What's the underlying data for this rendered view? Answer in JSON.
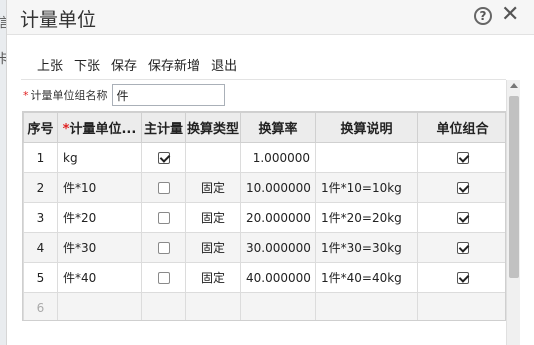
{
  "backdrop": {
    "text1": "信",
    "text2": "卡"
  },
  "window": {
    "title": "计量单位"
  },
  "toolbar": {
    "buttons": [
      "上张",
      "下张",
      "保存",
      "保存新增",
      "退出"
    ]
  },
  "form": {
    "group_name_label": "计量单位组名称",
    "group_name_value": "件"
  },
  "grid": {
    "headers": {
      "seq": "序号",
      "unit_name": "计量单位...",
      "main_unit": "主计量",
      "conv_type": "换算类型",
      "conv_rate": "换算率",
      "conv_desc": "换算说明",
      "unit_group": "单位组合"
    },
    "rows": [
      {
        "seq": "1",
        "unit_name": "kg",
        "main_unit": true,
        "conv_type": "",
        "conv_rate": "1.000000",
        "conv_desc": "",
        "unit_group": true
      },
      {
        "seq": "2",
        "unit_name": "件*10",
        "main_unit": false,
        "conv_type": "固定",
        "conv_rate": "10.000000",
        "conv_desc": "1件*10=10kg",
        "unit_group": true
      },
      {
        "seq": "3",
        "unit_name": "件*20",
        "main_unit": false,
        "conv_type": "固定",
        "conv_rate": "20.000000",
        "conv_desc": "1件*20=20kg",
        "unit_group": true
      },
      {
        "seq": "4",
        "unit_name": "件*30",
        "main_unit": false,
        "conv_type": "固定",
        "conv_rate": "30.000000",
        "conv_desc": "1件*30=30kg",
        "unit_group": true
      },
      {
        "seq": "5",
        "unit_name": "件*40",
        "main_unit": false,
        "conv_type": "固定",
        "conv_rate": "40.000000",
        "conv_desc": "1件*40=40kg",
        "unit_group": true
      }
    ],
    "empty_row_seq": "6"
  },
  "icons": {
    "help": "?",
    "close": "✕"
  },
  "colors": {
    "required": "#e02020",
    "header_bg": "#ececec"
  }
}
